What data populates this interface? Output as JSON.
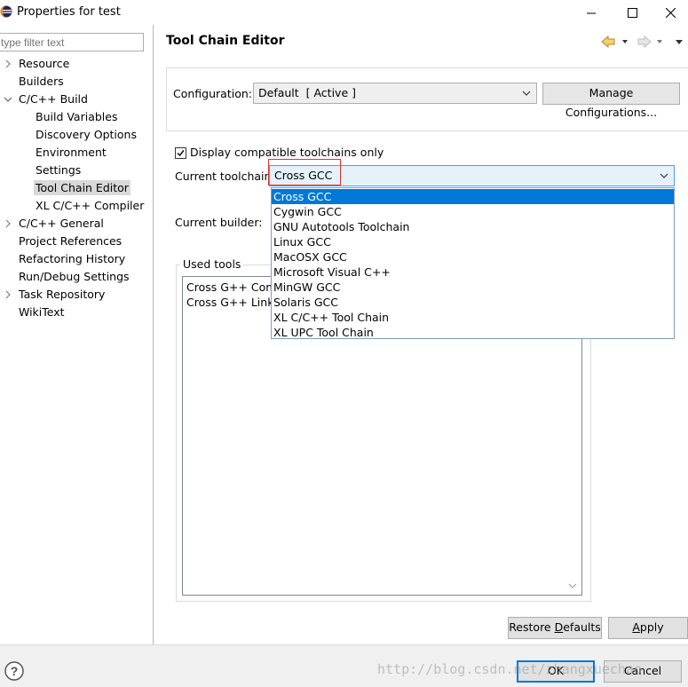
{
  "window": {
    "title": "Properties for test"
  },
  "filter": {
    "placeholder": "type filter text"
  },
  "tree": {
    "items": [
      {
        "label": "Resource",
        "level": 0,
        "twisty": "collapsed"
      },
      {
        "label": "Builders",
        "level": 0,
        "twisty": "none"
      },
      {
        "label": "C/C++ Build",
        "level": 0,
        "twisty": "expanded"
      },
      {
        "label": "Build Variables",
        "level": 1,
        "twisty": "none"
      },
      {
        "label": "Discovery Options",
        "level": 1,
        "twisty": "none"
      },
      {
        "label": "Environment",
        "level": 1,
        "twisty": "none"
      },
      {
        "label": "Settings",
        "level": 1,
        "twisty": "none"
      },
      {
        "label": "Tool Chain Editor",
        "level": 1,
        "twisty": "none",
        "selected": true
      },
      {
        "label": "XL C/C++ Compiler",
        "level": 1,
        "twisty": "none"
      },
      {
        "label": "C/C++ General",
        "level": 0,
        "twisty": "collapsed"
      },
      {
        "label": "Project References",
        "level": 0,
        "twisty": "none"
      },
      {
        "label": "Refactoring History",
        "level": 0,
        "twisty": "none"
      },
      {
        "label": "Run/Debug Settings",
        "level": 0,
        "twisty": "none"
      },
      {
        "label": "Task Repository",
        "level": 0,
        "twisty": "collapsed"
      },
      {
        "label": "WikiText",
        "level": 0,
        "twisty": "none"
      }
    ]
  },
  "page": {
    "title": "Tool Chain Editor"
  },
  "configuration": {
    "label": "Configuration:",
    "value": "Default  [ Active ]",
    "manage_label": "Manage Configurations..."
  },
  "compat": {
    "label": "Display compatible toolchains only",
    "checked": true
  },
  "toolchain": {
    "label": "Current toolchain:",
    "value": "Cross GCC",
    "options": [
      "Cross GCC",
      "Cygwin GCC",
      "GNU Autotools Toolchain",
      "Linux GCC",
      "MacOSX GCC",
      "Microsoft Visual C++",
      "MinGW GCC",
      "Solaris GCC",
      "XL C/C++ Tool Chain",
      "XL UPC Tool Chain"
    ],
    "selected_index": 0
  },
  "builder": {
    "label": "Current builder:"
  },
  "used_tools": {
    "label": "Used tools",
    "items": [
      "Cross G++ Com",
      "Cross G++ Linke"
    ]
  },
  "buttons": {
    "restore_prefix": "Restore ",
    "restore_underlined": "D",
    "restore_suffix": "efaults",
    "apply_underlined": "A",
    "apply_suffix": "pply",
    "ok": "OK",
    "cancel": "Cancel"
  },
  "watermark": "http://blog.csdn.net/zhangxuechao",
  "colors": {
    "selection": "#0078d7",
    "highlight_box": "#dd3333"
  },
  "icons": [
    "eclipse-icon",
    "minimize-icon",
    "maximize-icon",
    "close-icon",
    "back-arrow-icon",
    "forward-arrow-icon",
    "help-icon"
  ]
}
